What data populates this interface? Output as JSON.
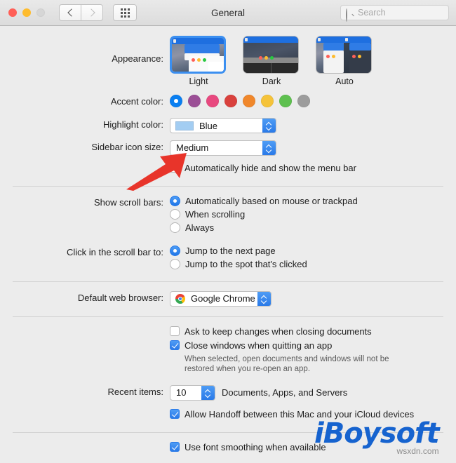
{
  "window": {
    "title": "General",
    "traffic_lights": [
      "close",
      "minimize",
      "zoom-disabled"
    ]
  },
  "toolbar": {
    "back_label": "Back",
    "forward_label": "Forward",
    "show_all_label": "Show All",
    "search_placeholder": "Search",
    "search_value": ""
  },
  "appearance": {
    "label": "Appearance:",
    "options": [
      {
        "name": "Light",
        "selected": true
      },
      {
        "name": "Dark",
        "selected": false
      },
      {
        "name": "Auto",
        "selected": false
      }
    ]
  },
  "accent_color": {
    "label": "Accent color:",
    "selected_index": 0,
    "swatches": [
      {
        "name": "blue",
        "hex": "#0a7ff1"
      },
      {
        "name": "purple",
        "hex": "#9b4f96"
      },
      {
        "name": "pink",
        "hex": "#e8487f"
      },
      {
        "name": "red",
        "hex": "#d9413d"
      },
      {
        "name": "orange",
        "hex": "#f0872b"
      },
      {
        "name": "yellow",
        "hex": "#f5c33a"
      },
      {
        "name": "green",
        "hex": "#5ec04f"
      },
      {
        "name": "gray",
        "hex": "#9c9c9c"
      }
    ]
  },
  "highlight_color": {
    "label": "Highlight color:",
    "value": "Blue",
    "swatch_hex": "#a3cdf2"
  },
  "sidebar_icon_size": {
    "label": "Sidebar icon size:",
    "value": "Medium"
  },
  "auto_hide_menu_bar": {
    "label": "Automatically hide and show the menu bar",
    "checked": false
  },
  "show_scroll_bars": {
    "label": "Show scroll bars:",
    "options": [
      {
        "label": "Automatically based on mouse or trackpad",
        "selected": true
      },
      {
        "label": "When scrolling",
        "selected": false
      },
      {
        "label": "Always",
        "selected": false
      }
    ]
  },
  "click_scroll_bar": {
    "label": "Click in the scroll bar to:",
    "options": [
      {
        "label": "Jump to the next page",
        "selected": true
      },
      {
        "label": "Jump to the spot that's clicked",
        "selected": false
      }
    ]
  },
  "default_web_browser": {
    "label": "Default web browser:",
    "value": "Google Chrome",
    "icon": "chrome-icon"
  },
  "document_options": {
    "ask_keep_changes": {
      "label": "Ask to keep changes when closing documents",
      "checked": false
    },
    "close_windows": {
      "label": "Close windows when quitting an app",
      "checked": true
    },
    "hint": "When selected, open documents and windows will not be restored when you re-open an app."
  },
  "recent_items": {
    "label": "Recent items:",
    "value": "10",
    "note": "Documents, Apps, and Servers"
  },
  "handoff": {
    "label": "Allow Handoff between this Mac and your iCloud devices",
    "checked": true
  },
  "font_smoothing": {
    "label": "Use font smoothing when available",
    "checked": true
  },
  "watermark": {
    "brand": "iBoysoft",
    "site": "wsxdn.com",
    "brand_hex": "#1663cf"
  }
}
